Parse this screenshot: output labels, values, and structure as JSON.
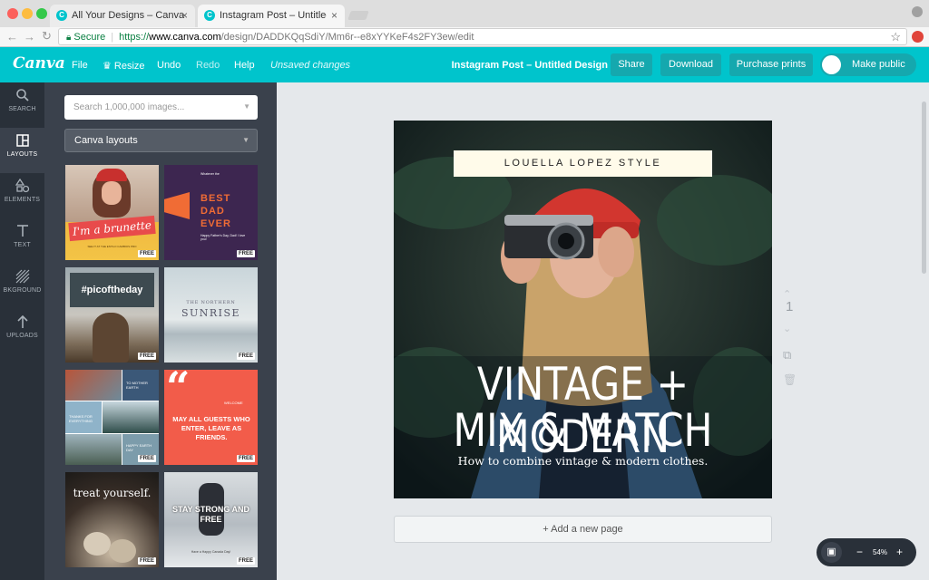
{
  "browser": {
    "tabs": [
      {
        "label": "All Your Designs – Canva",
        "active": false
      },
      {
        "label": "Instagram Post – Untitled Design",
        "active": true
      }
    ],
    "url": {
      "secure_label": "Secure",
      "scheme": "https://",
      "host": "www.canva.com",
      "path": "/design/DADDKQqSdiY/Mm6r--e8xYYKeF4s2FY3ew/edit"
    }
  },
  "header": {
    "logo": "Canva",
    "menu": {
      "file": "File",
      "resize": "Resize",
      "undo": "Undo",
      "redo": "Redo",
      "help": "Help",
      "status": "Unsaved changes"
    },
    "design_title": "Instagram Post – Untitled Design",
    "share": "Share",
    "download": "Download",
    "purchase": "Purchase prints",
    "make_public": "Make public"
  },
  "rail": [
    {
      "label": "SEARCH",
      "icon": "search-icon"
    },
    {
      "label": "LAYOUTS",
      "icon": "layouts-icon"
    },
    {
      "label": "ELEMENTS",
      "icon": "elements-icon"
    },
    {
      "label": "TEXT",
      "icon": "text-icon"
    },
    {
      "label": "BKGROUND",
      "icon": "background-icon"
    },
    {
      "label": "UPLOADS",
      "icon": "upload-icon"
    }
  ],
  "panel": {
    "search_placeholder": "Search 1,000,000 images...",
    "selected_category": "Canva layouts",
    "free_badge": "FREE",
    "templates": [
      {
        "title": "I'm a brunette",
        "sub": "SEE IT AT THE ESTILO CAMBIOS PRO"
      },
      {
        "title": "BEST DAD EVER",
        "top": "Whatever the",
        "sub": "Happy Father's Day, Dad! I love you!"
      },
      {
        "title": "#picoftheday"
      },
      {
        "title": "SUNRISE",
        "top": "THE NORTHERN"
      },
      {
        "title": "",
        "texts": [
          "TO MOTHER EARTH",
          "THANKS FOR EVERYTHING",
          "HAPPY EARTH DAY"
        ]
      },
      {
        "title": "MAY ALL GUESTS WHO ENTER, LEAVE AS FRIENDS.",
        "top": "WELCOME"
      },
      {
        "title": "treat yourself."
      },
      {
        "title": "STAY STRONG AND FREE",
        "sub": "Have a Happy Canada Day!"
      }
    ]
  },
  "design": {
    "name_tag": "LOUELLA LOPEZ STYLE",
    "headline_1": "VINTAGE + MODERN",
    "headline_2": "MIX & MATCH",
    "subline": "How to combine vintage & modern clothes."
  },
  "page_number": "1",
  "add_page": "+ Add a new page",
  "zoom": "54%"
}
